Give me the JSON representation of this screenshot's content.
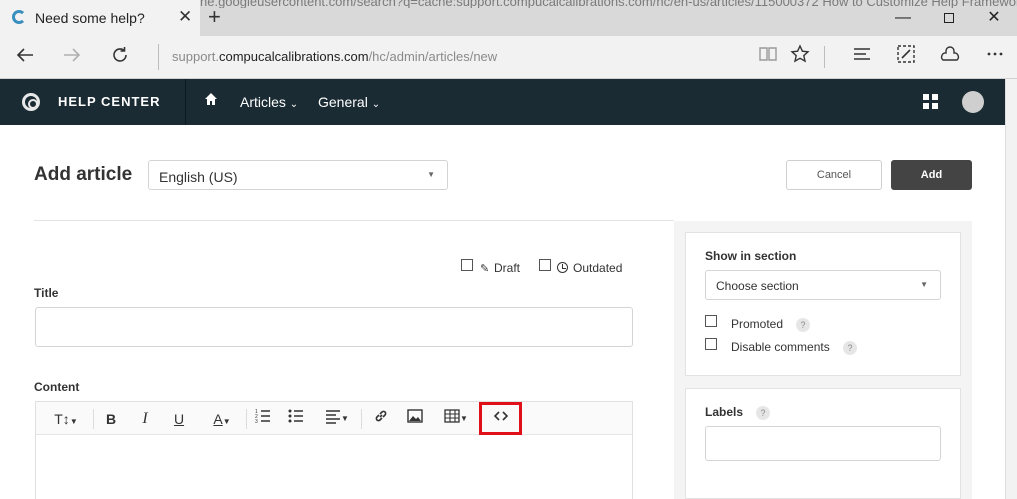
{
  "browser": {
    "background_url_text": "ne.googleusercontent.com/search?q=cache:support.compucalcalibrations.com/hc/en-us/articles/115000372 How to Customize Help Framework",
    "tab_title": "Need some help?",
    "tab_close": "✕",
    "new_tab": "+",
    "window": {
      "minimize": "—",
      "close": "✕"
    },
    "url_prefix": "support.",
    "url_host": "compucalcalibrations.com",
    "url_path": "/hc/admin/articles/new",
    "icons": [
      "back-arrow-icon",
      "forward-arrow-icon",
      "reload-icon",
      "reading-view-icon",
      "favorite-star-icon",
      "hub-icon",
      "web-note-icon",
      "share-icon",
      "more-icon"
    ]
  },
  "header": {
    "title": "HELP CENTER",
    "menu": {
      "articles": "Articles",
      "general": "General"
    },
    "colors": {
      "background": "#1a2b33"
    }
  },
  "main": {
    "page_title": "Add article",
    "language": "English (US)",
    "cancel_label": "Cancel",
    "add_label": "Add",
    "draft_label": "Draft",
    "outdated_label": "Outdated",
    "title_label": "Title",
    "content_label": "Content",
    "toolbar_items": [
      "format-size",
      "bold",
      "italic",
      "underline",
      "text-color",
      "ordered-list",
      "unordered-list",
      "align",
      "link",
      "image",
      "table",
      "source-code"
    ]
  },
  "sidebar": {
    "show_in_section_label": "Show in section",
    "section_placeholder": "Choose section",
    "promoted_label": "Promoted",
    "disable_comments_label": "Disable comments",
    "labels_label": "Labels",
    "help_mark": "?"
  },
  "annotation": {
    "highlight_color": "#e0101a"
  }
}
